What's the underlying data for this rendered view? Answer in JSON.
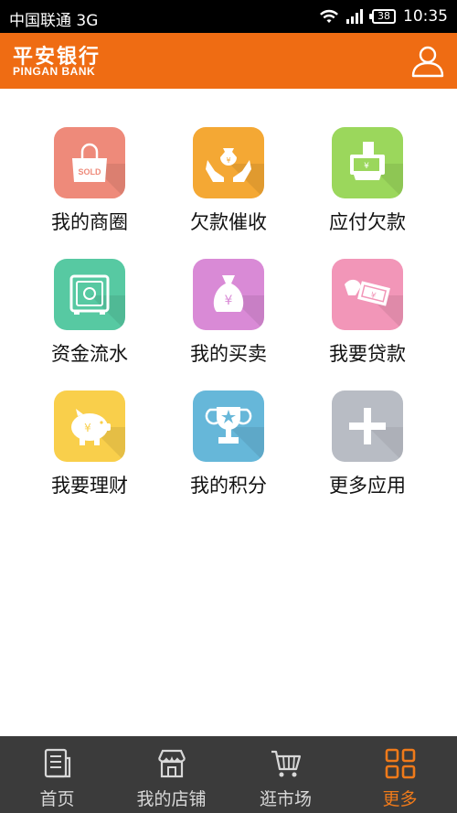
{
  "status_bar": {
    "carrier": "中国联通 3G",
    "battery": "38",
    "time": "10:35"
  },
  "header": {
    "logo_cn": "平安银行",
    "logo_en": "PINGAN BANK",
    "user_icon": "user-icon"
  },
  "grid": {
    "items": [
      {
        "label": "我的商圈",
        "icon": "shopping-bag-icon",
        "color": "#ee8a7a",
        "badge": "SOLD"
      },
      {
        "label": "欠款催收",
        "icon": "hands-money-icon",
        "color": "#f4a834"
      },
      {
        "label": "应付欠款",
        "icon": "cash-machine-icon",
        "color": "#9bd75c"
      },
      {
        "label": "资金流水",
        "icon": "safe-icon",
        "color": "#57c9a2"
      },
      {
        "label": "我的买卖",
        "icon": "money-bag-icon",
        "color": "#d98ad6"
      },
      {
        "label": "我要贷款",
        "icon": "hand-cash-icon",
        "color": "#f296b8"
      },
      {
        "label": "我要理财",
        "icon": "piggy-bank-icon",
        "color": "#f9cf4b"
      },
      {
        "label": "我的积分",
        "icon": "trophy-icon",
        "color": "#66b7d9"
      },
      {
        "label": "更多应用",
        "icon": "plus-icon",
        "color": "#b8bcc4"
      }
    ]
  },
  "tabbar": {
    "tabs": [
      {
        "label": "首页",
        "icon": "home-document-icon",
        "active": false
      },
      {
        "label": "我的店铺",
        "icon": "store-icon",
        "active": false
      },
      {
        "label": "逛市场",
        "icon": "cart-icon",
        "active": false
      },
      {
        "label": "更多",
        "icon": "grid-icon",
        "active": true
      }
    ]
  },
  "colors": {
    "brand_orange": "#ef6c13",
    "active_tab": "#ef7a1a",
    "tabbar_bg": "#3b3b3b"
  }
}
